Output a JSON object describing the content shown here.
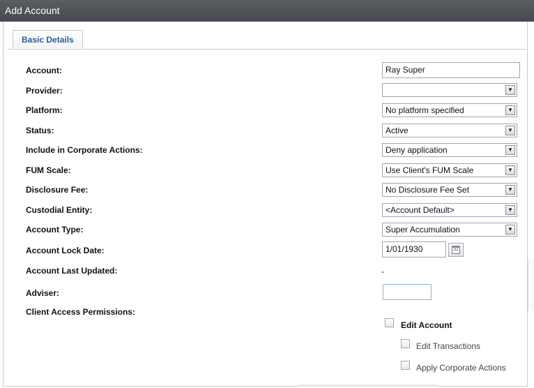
{
  "window": {
    "title": "Add Account"
  },
  "tabs": [
    {
      "label": "Basic Details"
    }
  ],
  "fields": {
    "account": {
      "label": "Account:",
      "value": "Ray Super"
    },
    "provider": {
      "label": "Provider:",
      "value": ""
    },
    "platform": {
      "label": "Platform:",
      "value": "No platform specified"
    },
    "status": {
      "label": "Status:",
      "value": "Active"
    },
    "corporate_actions": {
      "label": "Include in Corporate Actions:",
      "value": "Deny application"
    },
    "fum_scale": {
      "label": "FUM Scale:",
      "value": "Use Client's FUM Scale"
    },
    "disclosure_fee": {
      "label": "Disclosure Fee:",
      "value": "No Disclosure Fee Set"
    },
    "custodial_entity": {
      "label": "Custodial Entity:",
      "value": "<Account Default>"
    },
    "account_type": {
      "label": "Account Type:",
      "value": "Super Accumulation"
    },
    "lock_date": {
      "label": "Account Lock Date:",
      "value": "1/01/1930"
    },
    "last_updated": {
      "label": "Account Last Updated:",
      "value": "-"
    },
    "adviser": {
      "label": "Adviser:",
      "value": ""
    },
    "client_access": {
      "label": "Client Access Permissions:"
    }
  },
  "permissions": {
    "edit_account": {
      "label": "Edit Account",
      "checked": false
    },
    "edit_transactions": {
      "label": "Edit Transactions",
      "checked": false
    },
    "apply_corporate_actions": {
      "label": "Apply Corporate Actions",
      "checked": false
    }
  },
  "calendar_icon_text": "31"
}
